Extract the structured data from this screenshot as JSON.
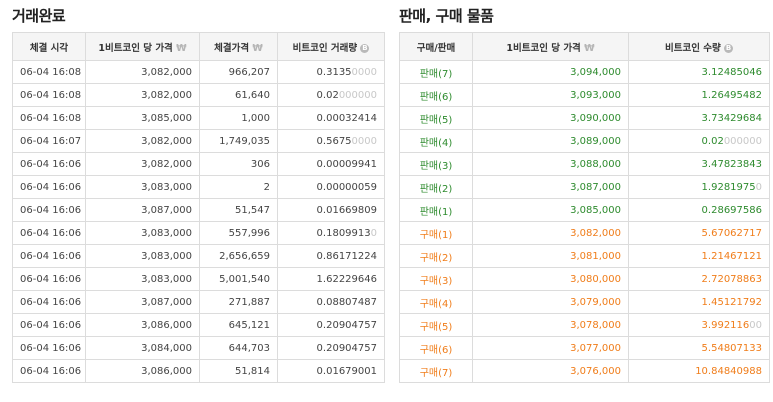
{
  "trades": {
    "title": "거래완료",
    "headers": {
      "time": "체결 시각",
      "price": "1비트코인 당 가격",
      "total": "체결가격",
      "amount": "비트코인 거래량"
    },
    "rows": [
      {
        "time": "06-04 16:08",
        "price": "3,082,000",
        "total": "966,207",
        "amt_main": "0.3135",
        "amt_fade": "0000"
      },
      {
        "time": "06-04 16:08",
        "price": "3,082,000",
        "total": "61,640",
        "amt_main": "0.02",
        "amt_fade": "000000"
      },
      {
        "time": "06-04 16:08",
        "price": "3,085,000",
        "total": "1,000",
        "amt_main": "0.00032414",
        "amt_fade": ""
      },
      {
        "time": "06-04 16:07",
        "price": "3,082,000",
        "total": "1,749,035",
        "amt_main": "0.5675",
        "amt_fade": "0000"
      },
      {
        "time": "06-04 16:06",
        "price": "3,082,000",
        "total": "306",
        "amt_main": "0.00009941",
        "amt_fade": ""
      },
      {
        "time": "06-04 16:06",
        "price": "3,083,000",
        "total": "2",
        "amt_main": "0.00000059",
        "amt_fade": ""
      },
      {
        "time": "06-04 16:06",
        "price": "3,087,000",
        "total": "51,547",
        "amt_main": "0.01669809",
        "amt_fade": ""
      },
      {
        "time": "06-04 16:06",
        "price": "3,083,000",
        "total": "557,996",
        "amt_main": "0.1809913",
        "amt_fade": "0"
      },
      {
        "time": "06-04 16:06",
        "price": "3,083,000",
        "total": "2,656,659",
        "amt_main": "0.86171224",
        "amt_fade": ""
      },
      {
        "time": "06-04 16:06",
        "price": "3,083,000",
        "total": "5,001,540",
        "amt_main": "1.62229646",
        "amt_fade": ""
      },
      {
        "time": "06-04 16:06",
        "price": "3,087,000",
        "total": "271,887",
        "amt_main": "0.08807487",
        "amt_fade": ""
      },
      {
        "time": "06-04 16:06",
        "price": "3,086,000",
        "total": "645,121",
        "amt_main": "0.20904757",
        "amt_fade": ""
      },
      {
        "time": "06-04 16:06",
        "price": "3,084,000",
        "total": "644,703",
        "amt_main": "0.20904757",
        "amt_fade": ""
      },
      {
        "time": "06-04 16:06",
        "price": "3,086,000",
        "total": "51,814",
        "amt_main": "0.01679001",
        "amt_fade": ""
      }
    ]
  },
  "orderbook": {
    "title": "판매, 구매 물품",
    "headers": {
      "type": "구매/판매",
      "price": "1비트코인 당 가격",
      "amount": "비트코인 수량"
    },
    "rows": [
      {
        "side": "sell",
        "type": "판매(7)",
        "price": "3,094,000",
        "amt_main": "3.12485046",
        "amt_fade": ""
      },
      {
        "side": "sell",
        "type": "판매(6)",
        "price": "3,093,000",
        "amt_main": "1.26495482",
        "amt_fade": ""
      },
      {
        "side": "sell",
        "type": "판매(5)",
        "price": "3,090,000",
        "amt_main": "3.73429684",
        "amt_fade": ""
      },
      {
        "side": "sell",
        "type": "판매(4)",
        "price": "3,089,000",
        "amt_main": "0.02",
        "amt_fade": "000000"
      },
      {
        "side": "sell",
        "type": "판매(3)",
        "price": "3,088,000",
        "amt_main": "3.47823843",
        "amt_fade": ""
      },
      {
        "side": "sell",
        "type": "판매(2)",
        "price": "3,087,000",
        "amt_main": "1.9281975",
        "amt_fade": "0"
      },
      {
        "side": "sell",
        "type": "판매(1)",
        "price": "3,085,000",
        "amt_main": "0.28697586",
        "amt_fade": ""
      },
      {
        "side": "buy",
        "type": "구매(1)",
        "price": "3,082,000",
        "amt_main": "5.67062717",
        "amt_fade": ""
      },
      {
        "side": "buy",
        "type": "구매(2)",
        "price": "3,081,000",
        "amt_main": "1.21467121",
        "amt_fade": ""
      },
      {
        "side": "buy",
        "type": "구매(3)",
        "price": "3,080,000",
        "amt_main": "2.72078863",
        "amt_fade": ""
      },
      {
        "side": "buy",
        "type": "구매(4)",
        "price": "3,079,000",
        "amt_main": "1.45121792",
        "amt_fade": ""
      },
      {
        "side": "buy",
        "type": "구매(5)",
        "price": "3,078,000",
        "amt_main": "3.992116",
        "amt_fade": "00"
      },
      {
        "side": "buy",
        "type": "구매(6)",
        "price": "3,077,000",
        "amt_main": "5.54807133",
        "amt_fade": ""
      },
      {
        "side": "buy",
        "type": "구매(7)",
        "price": "3,076,000",
        "amt_main": "10.84840988",
        "amt_fade": ""
      }
    ]
  },
  "icons": {
    "krw": "won-icon",
    "btc": "bitcoin-icon"
  },
  "colors": {
    "sell": "#2e8b2e",
    "buy": "#f07d1a",
    "header_bg": "#f5f5f5",
    "border": "#dcdcdc"
  }
}
